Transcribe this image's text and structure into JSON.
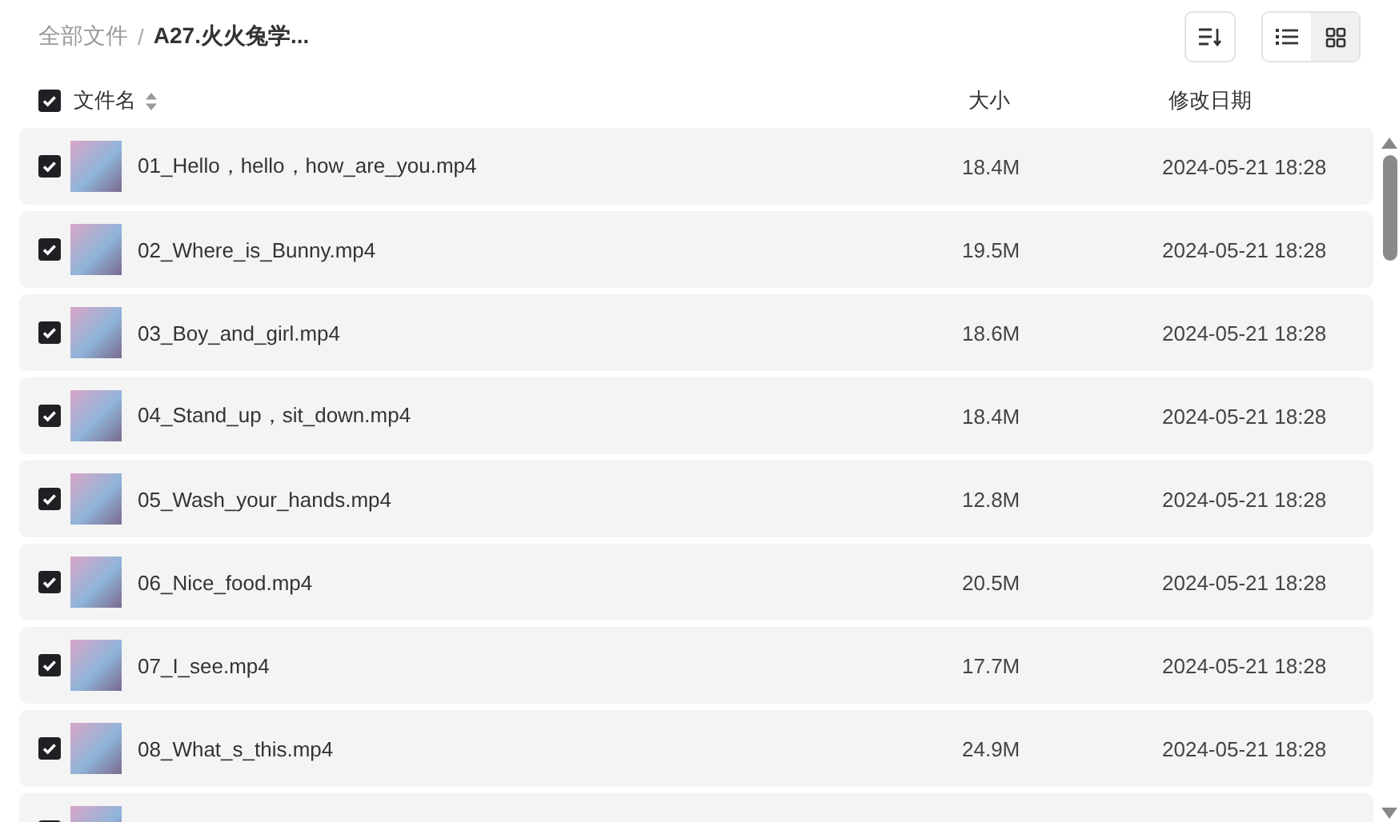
{
  "breadcrumb": [
    {
      "label": "全部文件",
      "current": false
    },
    {
      "separator": "/",
      "label": "A27.火火兔学...",
      "current": true
    }
  ],
  "view_modes": [
    {
      "kind": "list",
      "selected": false
    },
    {
      "kind": "grid",
      "selected": true
    }
  ],
  "table": {
    "select_all": {
      "checked": true
    },
    "columns": [
      "文件名",
      "大小",
      "修改日期"
    ],
    "rows": [
      {
        "checked": true,
        "name": "01_Hello，hello，how_are_you.mp4",
        "size": "18.4M",
        "modified": "2024-05-21 18:28"
      },
      {
        "checked": true,
        "name": "02_Where_is_Bunny.mp4",
        "size": "19.5M",
        "modified": "2024-05-21 18:28"
      },
      {
        "checked": true,
        "name": "03_Boy_and_girl.mp4",
        "size": "18.6M",
        "modified": "2024-05-21 18:28"
      },
      {
        "checked": true,
        "name": "04_Stand_up，sit_down.mp4",
        "size": "18.4M",
        "modified": "2024-05-21 18:28"
      },
      {
        "checked": true,
        "name": "05_Wash_your_hands.mp4",
        "size": "12.8M",
        "modified": "2024-05-21 18:28"
      },
      {
        "checked": true,
        "name": "06_Nice_food.mp4",
        "size": "20.5M",
        "modified": "2024-05-21 18:28"
      },
      {
        "checked": true,
        "name": "07_I_see.mp4",
        "size": "17.7M",
        "modified": "2024-05-21 18:28"
      },
      {
        "checked": true,
        "name": "08_What_s_this.mp4",
        "size": "24.9M",
        "modified": "2024-05-21 18:28"
      },
      {
        "checked": true
      }
    ]
  }
}
